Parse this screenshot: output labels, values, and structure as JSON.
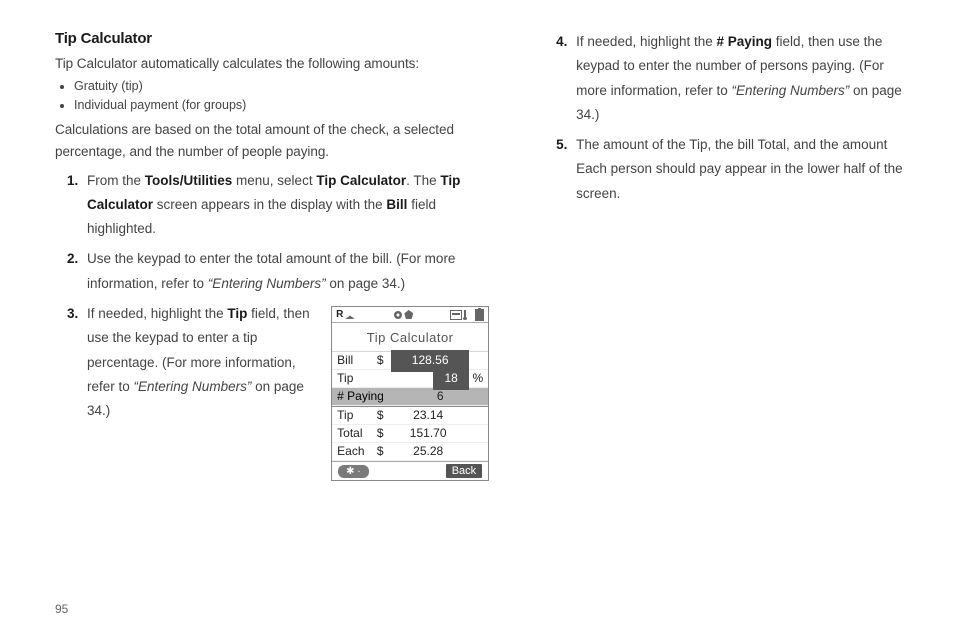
{
  "page_number": "95",
  "heading": "Tip Calculator",
  "intro": "Tip Calculator automatically calculates the following amounts:",
  "bullets": [
    "Gratuity (tip)",
    "Individual payment (for groups)"
  ],
  "lead": "Calculations are based on the total amount of the check, a selected percentage, and the number of people paying.",
  "steps": {
    "s1": {
      "num": "1.",
      "a": "From the ",
      "b": "Tools/Utilities",
      "c": " menu, select ",
      "d": "Tip Calculator",
      "e": ". The ",
      "f": "Tip Calculator",
      "g": " screen appears in the display with the ",
      "h": "Bill",
      "i": " field highlighted."
    },
    "s2": {
      "num": "2.",
      "a": "Use the keypad to enter the total amount of the bill. (For more information, refer to ",
      "b": "“Entering Numbers”",
      "c": "  on page 34.)"
    },
    "s3": {
      "num": "3.",
      "a": "If needed, highlight the ",
      "b": "Tip",
      "c": " field, then use the keypad to enter a tip percentage. (For more information, refer to ",
      "d": "“Entering Numbers”",
      "e": "  on page 34.)"
    },
    "s4": {
      "num": "4.",
      "a": "If needed, highlight the ",
      "b": "# Paying",
      "c": " field, then use the keypad to enter the number of persons paying. (For more information, refer to ",
      "d": "“Entering Numbers”",
      "e": "  on page 34.)"
    },
    "s5": {
      "num": "5.",
      "t": "The amount of the Tip, the bill Total, and the amount Each person should pay appear in the lower half of the screen."
    }
  },
  "phone": {
    "title": "Tip Calculator",
    "rows": {
      "bill": {
        "label": "Bill",
        "cur": "$",
        "val": "128.56"
      },
      "tip_in": {
        "label": "Tip",
        "val": "18",
        "unit": "%"
      },
      "paying": {
        "label": "# Paying",
        "val": "6"
      },
      "tip": {
        "label": "Tip",
        "cur": "$",
        "val": "23.14"
      },
      "total": {
        "label": "Total",
        "cur": "$",
        "val": "151.70"
      },
      "each": {
        "label": "Each",
        "cur": "$",
        "val": "25.28"
      }
    },
    "soft_left": "✱  ·",
    "soft_right": "Back",
    "status_left": "R",
    "status_mid": ""
  }
}
